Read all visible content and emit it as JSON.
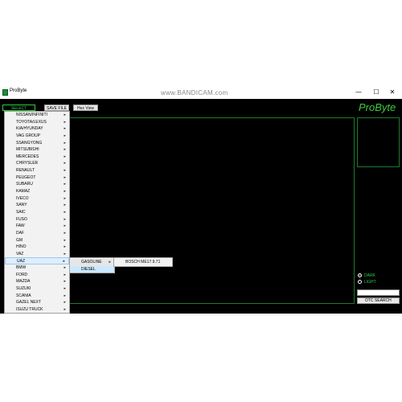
{
  "window": {
    "title": "ProByte",
    "controls": {
      "minimize": "—",
      "maximize": "☐",
      "close": "✕"
    }
  },
  "watermark": "www.BANDICAM.com",
  "toolbar": {
    "select_module": "SELECT MODULE",
    "save_file": "SAVE FILE",
    "hex_view": "Hex View"
  },
  "logo": "ProByte",
  "theme": {
    "dark_label": "DARK",
    "light_label": "LIGHT",
    "selected": "DARK"
  },
  "dtc": {
    "search_value": "",
    "search_button": "DTC SEARCH"
  },
  "module_menu": {
    "items": [
      "NISSAN/INFINITI",
      "TOYOTA/LEXUS",
      "KIA/HYUNDAY",
      "VAG GROUP",
      "SSANGYONG",
      "MITSUBISHI",
      "MERCEDES",
      "CHRYSLER",
      "RENAULT",
      "PEUGEOT",
      "SUBARU",
      "KAMAZ",
      "IVECO",
      "SANY",
      "SAIC",
      "FUSO",
      "FAW",
      "DAF",
      "GM",
      "HINO",
      "VAZ",
      "UAZ",
      "BMW",
      "FORD",
      "MAZDA",
      "SUZUKI",
      "SCANIA",
      "GAZEL NEXT",
      "ISUZU TRUCK"
    ],
    "highlighted": "UAZ"
  },
  "fuel_menu": {
    "items": [
      "GASOLINE",
      "DIESEL"
    ],
    "highlighted": "DIESEL"
  },
  "ecu_menu": {
    "items": [
      "BOSCH ME17.9.71"
    ]
  },
  "colors": {
    "background": "#000000",
    "accent_green": "#2ecc40",
    "panel_border": "#1d7a2e",
    "menu_bg": "#f2f2f2",
    "menu_highlight": "#cce8ff"
  }
}
